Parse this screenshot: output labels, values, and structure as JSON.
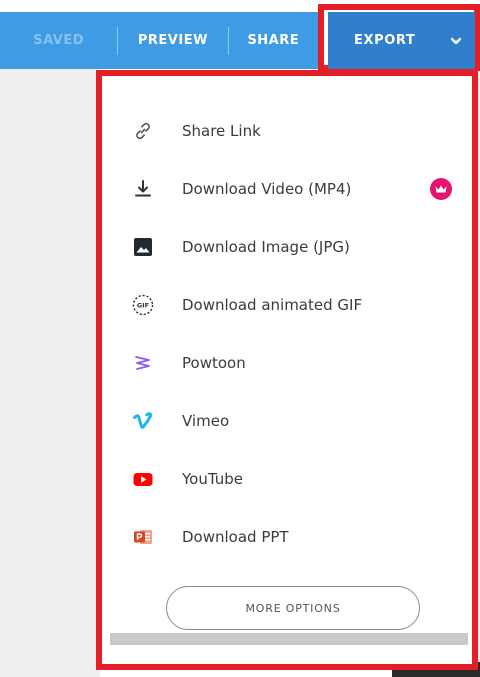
{
  "toolbar": {
    "saved_label": "SAVED",
    "preview_label": "PREVIEW",
    "share_label": "SHARE",
    "export_label": "EXPORT",
    "colors": {
      "bar": "#3f9be3",
      "export": "#2f7fcc",
      "highlight": "#e41e26"
    }
  },
  "menu": {
    "items": [
      {
        "label": "Share Link",
        "icon": "link-icon"
      },
      {
        "label": "Download Video (MP4)",
        "icon": "download-icon",
        "badge": "crown-icon"
      },
      {
        "label": "Download Image (JPG)",
        "icon": "image-icon"
      },
      {
        "label": "Download animated GIF",
        "icon": "gif-icon",
        "icon_text": "GIF"
      },
      {
        "label": "Powtoon",
        "icon": "powtoon-logo-icon"
      },
      {
        "label": "Vimeo",
        "icon": "vimeo-logo-icon"
      },
      {
        "label": "YouTube",
        "icon": "youtube-logo-icon"
      },
      {
        "label": "Download PPT",
        "icon": "powerpoint-icon"
      }
    ],
    "more_options_label": "MORE OPTIONS",
    "colors": {
      "premium_badge": "#e5156e",
      "powtoon": "#8a5cf5",
      "vimeo": "#1ab7ea",
      "youtube": "#ff0000",
      "ppt": "#d24726"
    }
  }
}
